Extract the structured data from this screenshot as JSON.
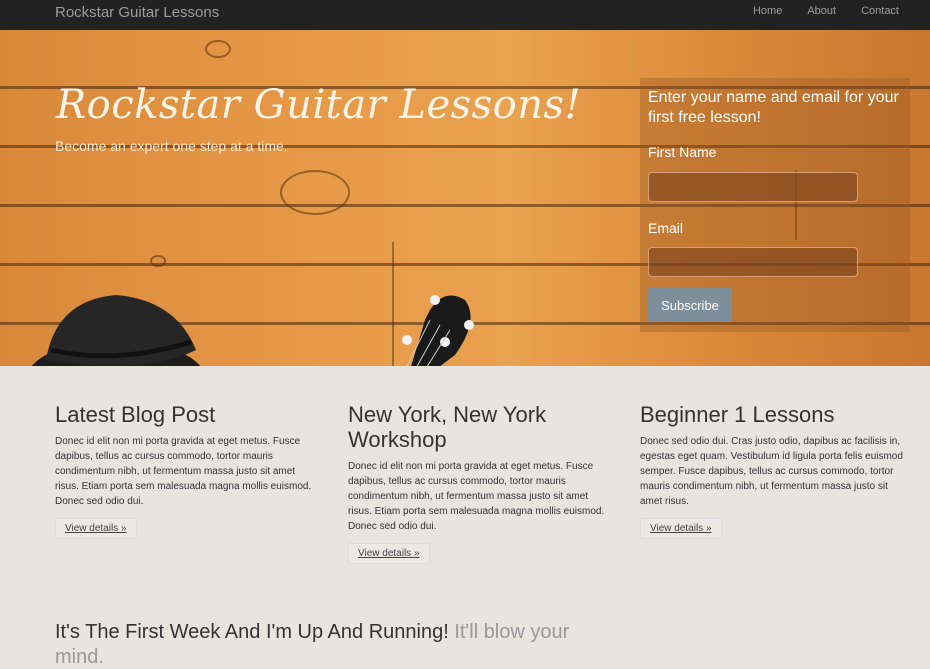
{
  "navbar": {
    "brand": "Rockstar Guitar Lessons",
    "links": [
      "Home",
      "About",
      "Contact"
    ]
  },
  "hero": {
    "title": "Rockstar Guitar Lessons!",
    "subtitle": "Become an expert one step at a time."
  },
  "signup": {
    "heading": "Enter your name and email for your first free lesson!",
    "first_name_label": "First Name",
    "first_name_value": "",
    "email_label": "Email",
    "email_value": "",
    "button": "Subscribe"
  },
  "columns": [
    {
      "title": "Latest Blog Post",
      "text": "Donec id elit non mi porta gravida at eget metus. Fusce dapibus, tellus ac cursus commodo, tortor mauris condimentum nibh, ut fermentum massa justo sit amet risus. Etiam porta sem malesuada magna mollis euismod. Donec sed odio dui.",
      "button": "View details »"
    },
    {
      "title": "New York, New York Workshop",
      "text": "Donec id elit non mi porta gravida at eget metus. Fusce dapibus, tellus ac cursus commodo, tortor mauris condimentum nibh, ut fermentum massa justo sit amet risus. Etiam porta sem malesuada magna mollis euismod. Donec sed odio dui.",
      "button": "View details »"
    },
    {
      "title": "Beginner 1 Lessons",
      "text": "Donec sed odio dui. Cras justo odio, dapibus ac facilisis in, egestas eget quam. Vestibulum id ligula porta felis euismod semper. Fusce dapibus, tellus ac cursus commodo, tortor mauris condimentum nibh, ut fermentum massa justo sit amet risus.",
      "button": "View details »"
    }
  ],
  "featurette": {
    "heading": "It's The First Week And I'm Up And Running!",
    "muted": "It'll blow your mind."
  },
  "colors": {
    "navbar": "#222222",
    "button": "#7e8e9b",
    "background": "#e8e4df"
  }
}
